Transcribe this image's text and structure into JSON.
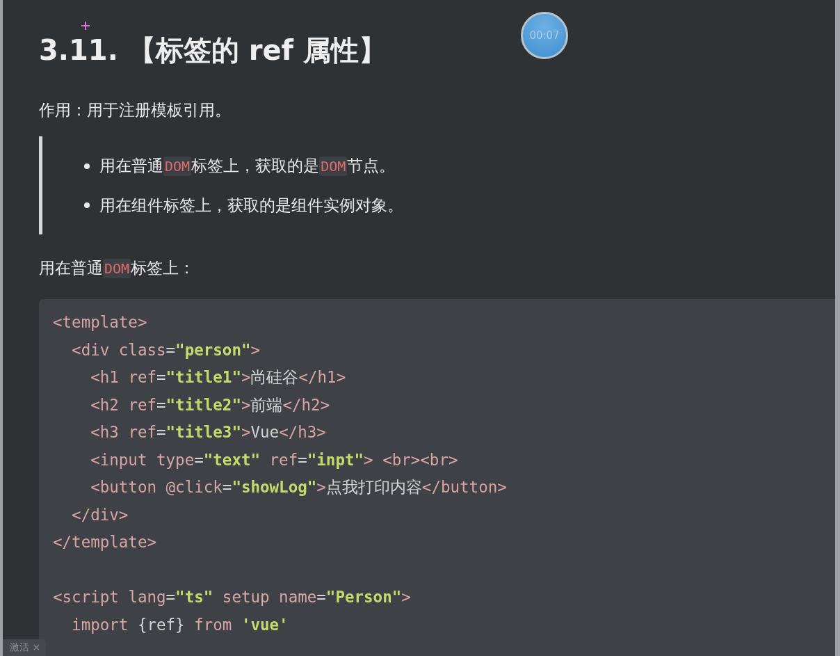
{
  "heading": "3.11. 【标签的 ref 属性】",
  "timer": "00:07",
  "intro": "作用：用于注册模板引用。",
  "bullets": [
    [
      {
        "kind": "text",
        "text": "用在普通"
      },
      {
        "kind": "code",
        "text": "DOM"
      },
      {
        "kind": "text",
        "text": "标签上，获取的是"
      },
      {
        "kind": "code",
        "text": "DOM"
      },
      {
        "kind": "text",
        "text": "节点。"
      }
    ],
    [
      {
        "kind": "text",
        "text": "用在组件标签上，获取的是组件实例对象。"
      }
    ]
  ],
  "subheading": [
    {
      "kind": "text",
      "text": "用在普通"
    },
    {
      "kind": "code",
      "text": "DOM"
    },
    {
      "kind": "text",
      "text": "标签上："
    }
  ],
  "code_sections": [
    [
      [
        {
          "kind": "tag",
          "text": "<template>"
        }
      ],
      [
        {
          "kind": "tag",
          "text": "  <div "
        },
        {
          "kind": "attr",
          "text": "class"
        },
        {
          "kind": "plain",
          "text": "="
        },
        {
          "kind": "str",
          "text": "\"person\""
        },
        {
          "kind": "tag",
          "text": ">"
        }
      ],
      [
        {
          "kind": "tag",
          "text": "    <h1 "
        },
        {
          "kind": "attr",
          "text": "ref"
        },
        {
          "kind": "plain",
          "text": "="
        },
        {
          "kind": "str",
          "text": "\"title1\""
        },
        {
          "kind": "tag",
          "text": ">"
        },
        {
          "kind": "plain",
          "text": "尚硅谷"
        },
        {
          "kind": "tag",
          "text": "</h1>"
        }
      ],
      [
        {
          "kind": "tag",
          "text": "    <h2 "
        },
        {
          "kind": "attr",
          "text": "ref"
        },
        {
          "kind": "plain",
          "text": "="
        },
        {
          "kind": "str",
          "text": "\"title2\""
        },
        {
          "kind": "tag",
          "text": ">"
        },
        {
          "kind": "plain",
          "text": "前端"
        },
        {
          "kind": "tag",
          "text": "</h2>"
        }
      ],
      [
        {
          "kind": "tag",
          "text": "    <h3 "
        },
        {
          "kind": "attr",
          "text": "ref"
        },
        {
          "kind": "plain",
          "text": "="
        },
        {
          "kind": "str",
          "text": "\"title3\""
        },
        {
          "kind": "tag",
          "text": ">"
        },
        {
          "kind": "plain",
          "text": "Vue"
        },
        {
          "kind": "tag",
          "text": "</h3>"
        }
      ],
      [
        {
          "kind": "tag",
          "text": "    <input "
        },
        {
          "kind": "attr",
          "text": "type"
        },
        {
          "kind": "plain",
          "text": "="
        },
        {
          "kind": "str",
          "text": "\"text\""
        },
        {
          "kind": "attr",
          "text": " ref"
        },
        {
          "kind": "plain",
          "text": "="
        },
        {
          "kind": "str",
          "text": "\"inpt\""
        },
        {
          "kind": "tag",
          "text": "> <br><br>"
        }
      ],
      [
        {
          "kind": "tag",
          "text": "    <button "
        },
        {
          "kind": "attr",
          "text": "@click"
        },
        {
          "kind": "plain",
          "text": "="
        },
        {
          "kind": "str",
          "text": "\"showLog\""
        },
        {
          "kind": "tag",
          "text": ">"
        },
        {
          "kind": "plain",
          "text": "点我打印内容"
        },
        {
          "kind": "tag",
          "text": "</button>"
        }
      ],
      [
        {
          "kind": "tag",
          "text": "  </div>"
        }
      ],
      [
        {
          "kind": "tag",
          "text": "</template>"
        }
      ]
    ],
    [
      [
        {
          "kind": "tag",
          "text": "<script "
        },
        {
          "kind": "attr",
          "text": "lang"
        },
        {
          "kind": "plain",
          "text": "="
        },
        {
          "kind": "str",
          "text": "\"ts\""
        },
        {
          "kind": "attr",
          "text": " setup name"
        },
        {
          "kind": "plain",
          "text": "="
        },
        {
          "kind": "str",
          "text": "\"Person\""
        },
        {
          "kind": "tag",
          "text": ">"
        }
      ],
      [
        {
          "kind": "attr",
          "text": "  import "
        },
        {
          "kind": "plain",
          "text": "{ref}"
        },
        {
          "kind": "attr",
          "text": " from "
        },
        {
          "kind": "str",
          "text": "'vue'"
        }
      ]
    ]
  ],
  "bottom_tab": "激活 ×"
}
